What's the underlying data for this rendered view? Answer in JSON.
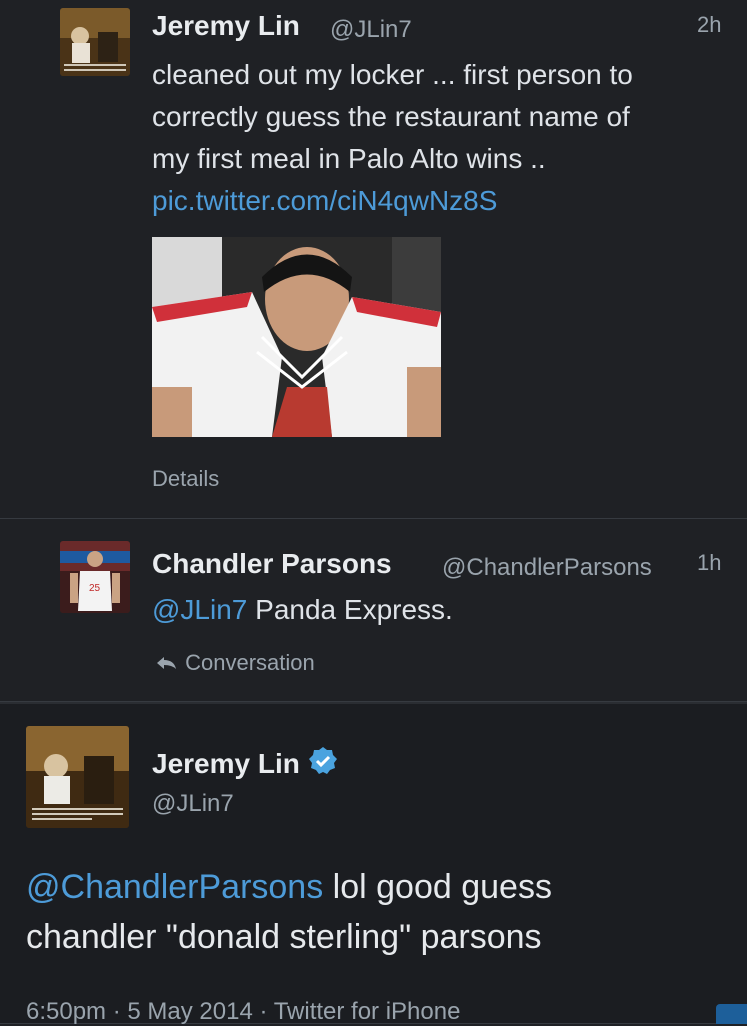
{
  "tweets": [
    {
      "name": "Jeremy Lin",
      "handle": "@JLin7",
      "time": "2h",
      "text_lines": [
        "cleaned out my locker ... first person to",
        "correctly guess the restaurant name of",
        "my first meal in Palo Alto wins .."
      ],
      "link": "pic.twitter.com/ciN4qwNz8S",
      "details_label": "Details"
    },
    {
      "name": "Chandler Parsons",
      "handle": "@ChandlerParsons",
      "time": "1h",
      "mention": "@JLin7",
      "text_rest": " Panda Express.",
      "conversation_label": "Conversation"
    },
    {
      "name": "Jeremy Lin",
      "handle": "@JLin7",
      "mention": "@ChandlerParsons",
      "line1_rest": " lol good guess",
      "line2": "chandler \"donald sterling\" parsons",
      "meta": "6:50pm · 5 May 2014 · Twitter for iPhone"
    }
  ],
  "colors": {
    "background": "#1f2125",
    "link": "#4d9bd8",
    "muted": "#9aa4ad",
    "verified": "#4aa3df"
  },
  "icons": [
    "verified-badge-icon",
    "reply-arrow-icon"
  ]
}
